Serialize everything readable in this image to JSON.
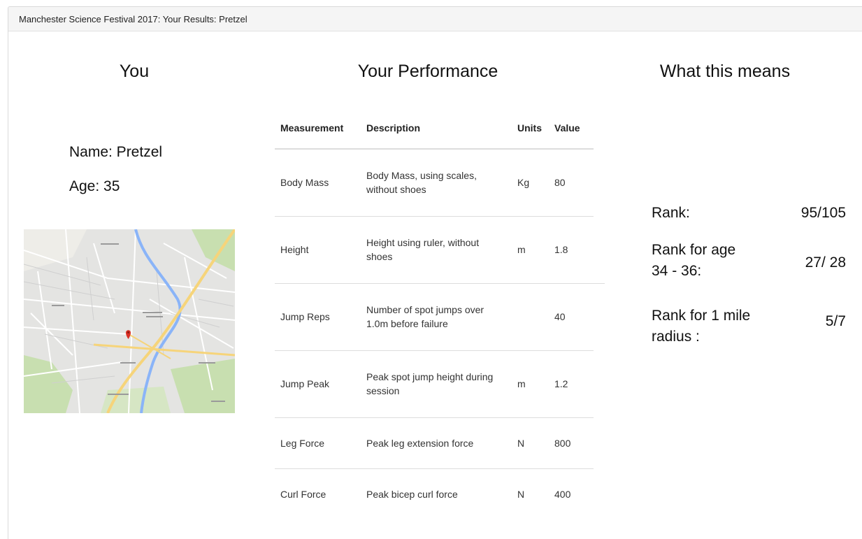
{
  "header": {
    "title": "Manchester Science Festival 2017: Your Results: Pretzel"
  },
  "you": {
    "title": "You",
    "name_line": "Name: Pretzel",
    "age_line": "Age: 35"
  },
  "performance": {
    "title": "Your Performance",
    "columns": [
      "Measurement",
      "Description",
      "Units",
      "Value"
    ],
    "rows": [
      {
        "measurement": "Body Mass",
        "description": "Body Mass, using scales, without shoes",
        "units": "Kg",
        "value": "80"
      },
      {
        "measurement": "Height",
        "description": "Height using ruler, without shoes",
        "units": "m",
        "value": "1.8"
      },
      {
        "measurement": "Jump Reps",
        "description": "Number of spot jumps over 1.0m before failure",
        "units": "",
        "value": "40"
      },
      {
        "measurement": "Jump Peak",
        "description": "Peak spot jump height during session",
        "units": "m",
        "value": "1.2"
      },
      {
        "measurement": "Leg Force",
        "description": "Peak leg extension force",
        "units": "N",
        "value": "800"
      },
      {
        "measurement": "Curl Force",
        "description": "Peak bicep curl force",
        "units": "N",
        "value": "400"
      }
    ]
  },
  "meaning": {
    "title": "What this means",
    "ranks": [
      {
        "label_line1": "Rank:",
        "label_line2": "",
        "value": "95/105"
      },
      {
        "label_line1": "Rank for age",
        "label_line2": "34 - 36:",
        "value": "27/ 28"
      },
      {
        "label_line1": "Rank for 1 mile",
        "label_line2": "radius :",
        "value": "5/7"
      }
    ]
  },
  "colors": {
    "map_road_major": "#f6d47a",
    "map_river": "#8ab4f8",
    "map_park": "#c8dfb0",
    "map_pin": "#d93025"
  }
}
